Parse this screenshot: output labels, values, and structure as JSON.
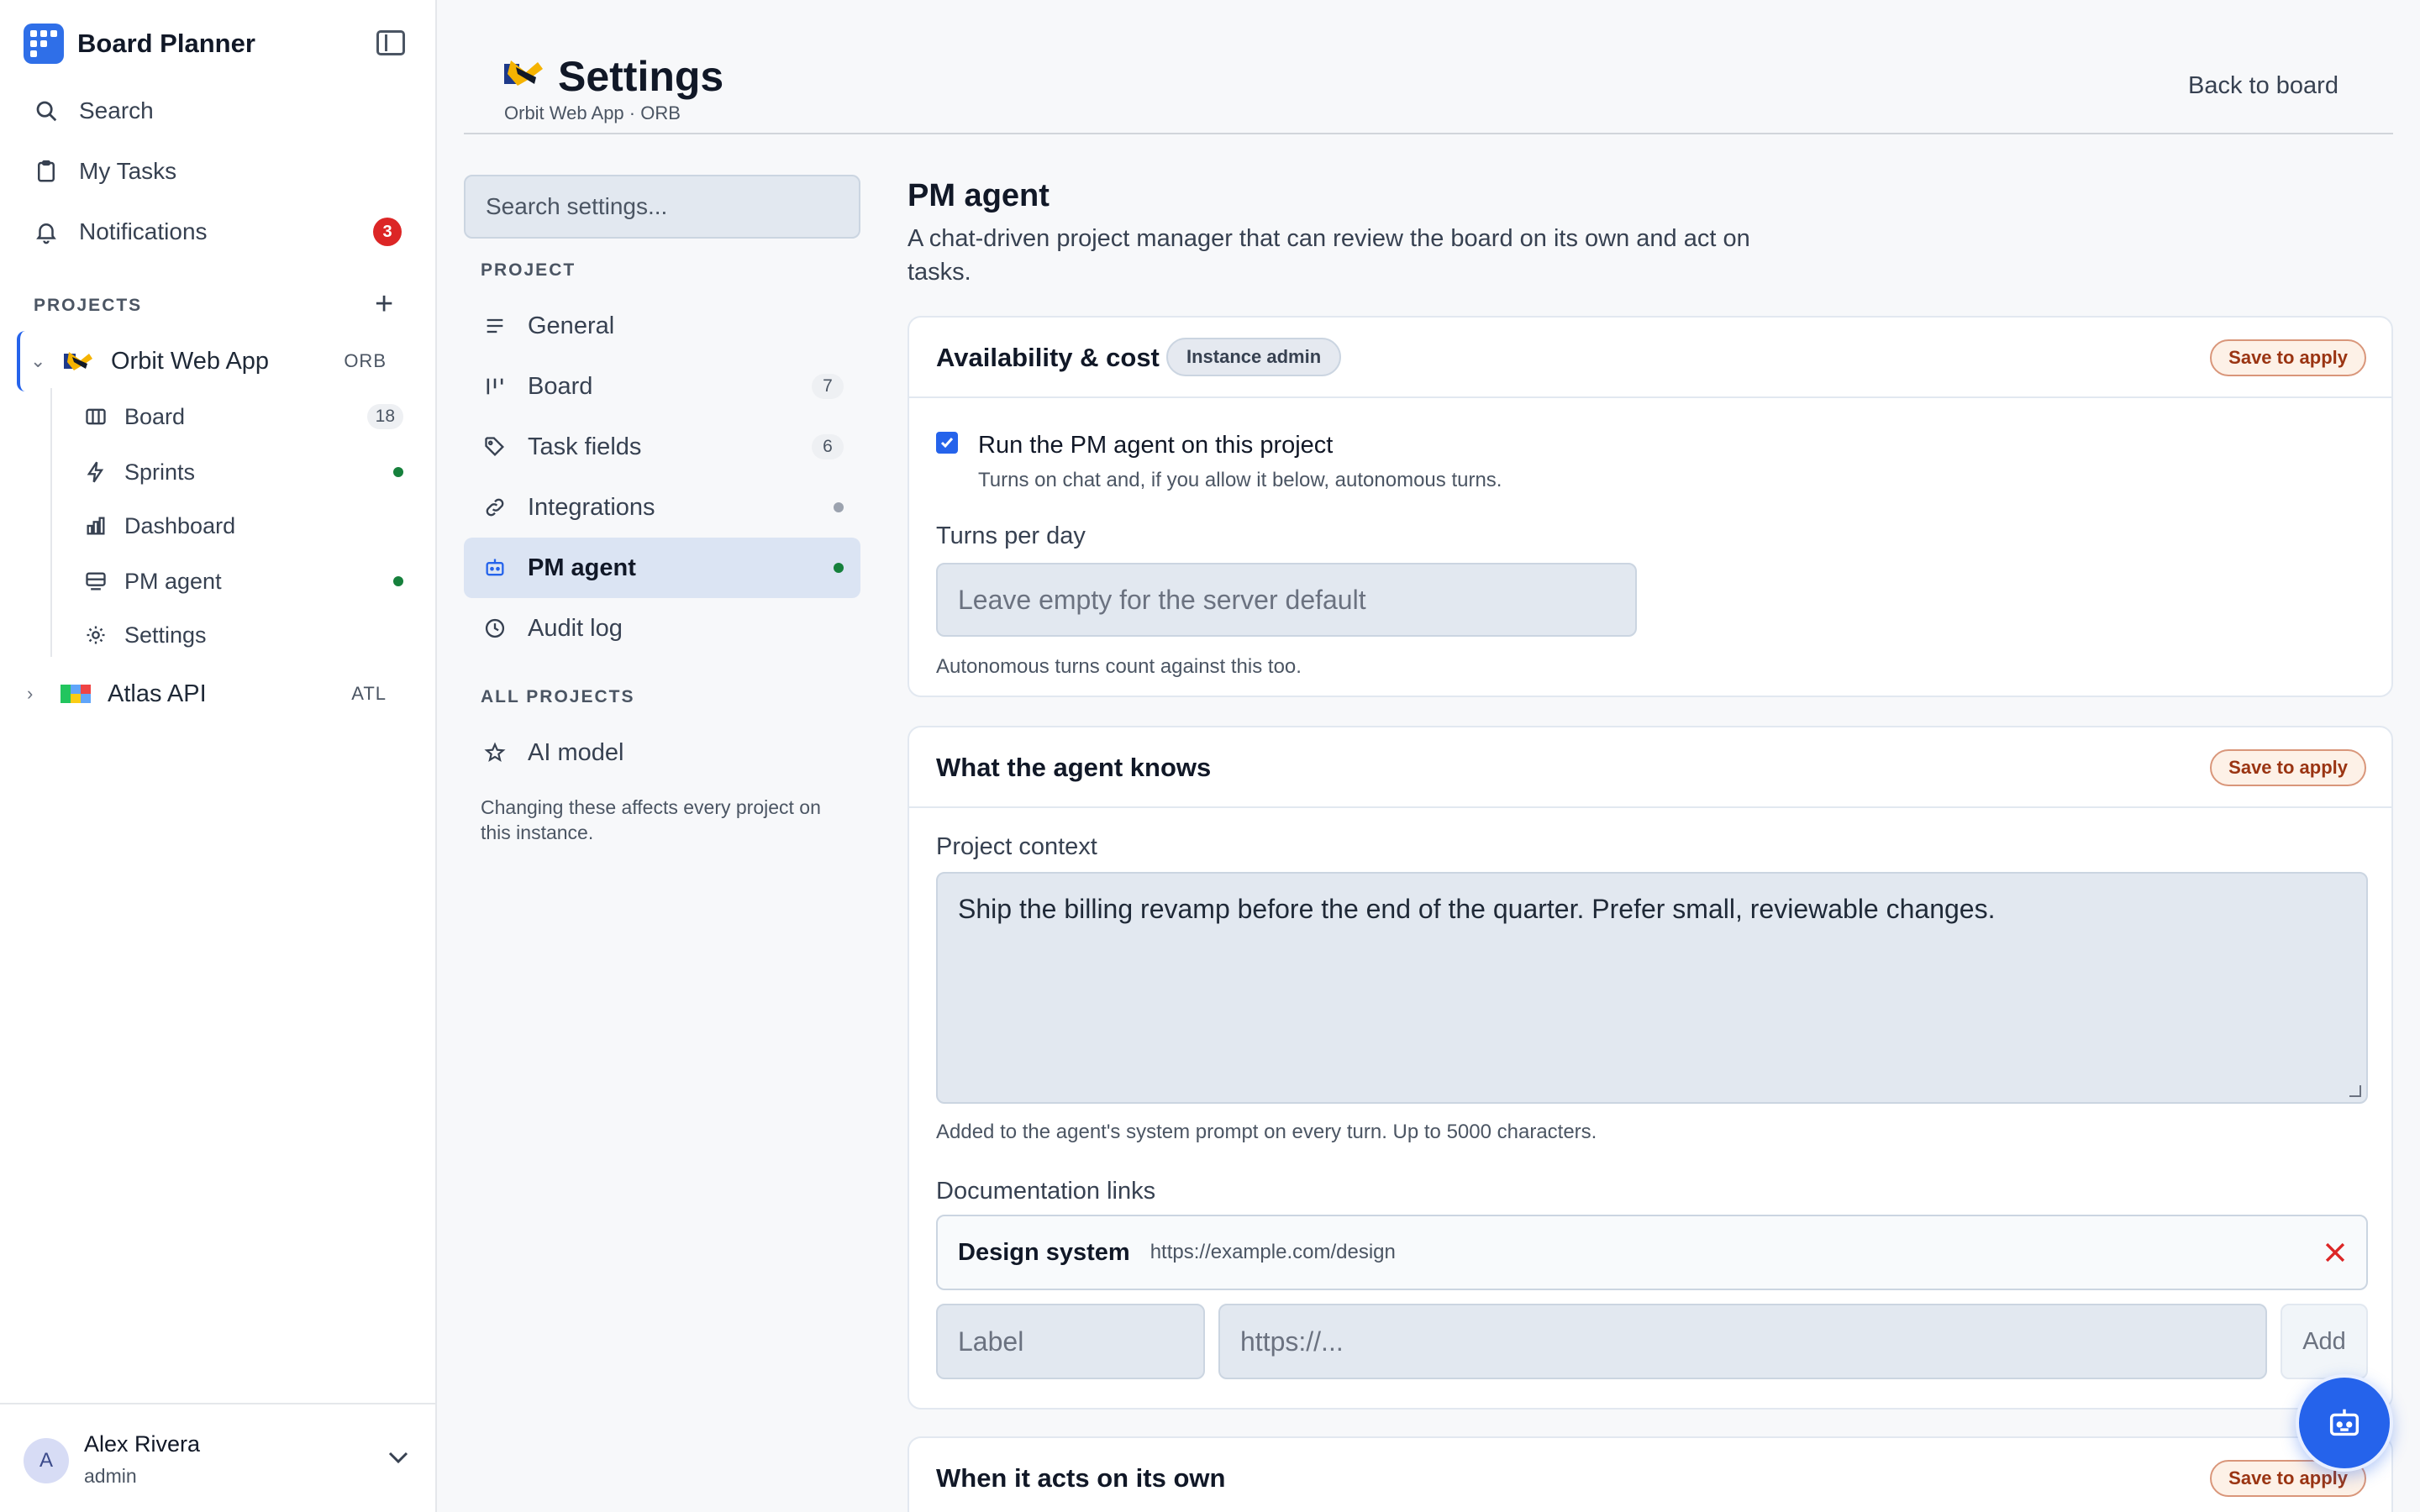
{
  "app": {
    "title": "Board Planner"
  },
  "sidebar": {
    "nav": [
      {
        "label": "Search",
        "icon": "search-icon"
      },
      {
        "label": "My Tasks",
        "icon": "clipboard-icon"
      },
      {
        "label": "Notifications",
        "icon": "bell-icon",
        "badge": "3"
      }
    ],
    "projects_label": "PROJECTS",
    "projects": [
      {
        "name": "Orbit Web App",
        "key": "ORB",
        "expanded": true,
        "children": [
          {
            "label": "Board",
            "icon": "board-icon",
            "count": "18"
          },
          {
            "label": "Sprints",
            "icon": "lightning-icon",
            "status": "green-dot"
          },
          {
            "label": "Dashboard",
            "icon": "chart-icon"
          },
          {
            "label": "PM agent",
            "icon": "monitor-icon",
            "status": "green-dot"
          },
          {
            "label": "Settings",
            "icon": "gear-icon"
          }
        ]
      },
      {
        "name": "Atlas API",
        "key": "ATL",
        "expanded": false
      }
    ],
    "user": {
      "initial": "A",
      "name": "Alex Rivera",
      "role": "admin"
    }
  },
  "header": {
    "title": "Settings",
    "subtitle": "Orbit Web App · ORB",
    "back_label": "Back to board"
  },
  "settings_nav": {
    "search_placeholder": "Search settings...",
    "project_label": "PROJECT",
    "project_items": [
      {
        "label": "General",
        "icon": "lines-icon"
      },
      {
        "label": "Board",
        "icon": "columns-icon",
        "count": "7"
      },
      {
        "label": "Task fields",
        "icon": "tag-icon",
        "count": "6"
      },
      {
        "label": "Integrations",
        "icon": "link-icon",
        "status": "gray-dot"
      },
      {
        "label": "PM agent",
        "icon": "robot-icon",
        "status": "green-dot",
        "active": true
      },
      {
        "label": "Audit log",
        "icon": "clock-icon"
      }
    ],
    "all_projects_label": "ALL PROJECTS",
    "all_items": [
      {
        "label": "AI model",
        "icon": "star-icon"
      }
    ],
    "note": "Changing these affects every project on this instance."
  },
  "main": {
    "title": "PM agent",
    "description": "A chat-driven project manager that can review the board on its own and act on tasks.",
    "cards": {
      "availability": {
        "title": "Availability & cost",
        "tag": "Instance admin",
        "save_label": "Save to apply",
        "checkbox_label": "Run the PM agent on this project",
        "checkbox_checked": true,
        "checkbox_help": "Turns on chat and, if you allow it below, autonomous turns.",
        "turns_label": "Turns per day",
        "turns_placeholder": "Leave empty for the server default",
        "turns_help": "Autonomous turns count against this too."
      },
      "knowledge": {
        "title": "What the agent knows",
        "save_label": "Save to apply",
        "context_label": "Project context",
        "context_value": "Ship the billing revamp before the end of the quarter. Prefer small, reviewable changes.",
        "context_help": "Added to the agent's system prompt on every turn. Up to 5000 characters.",
        "docs_label": "Documentation links",
        "links": [
          {
            "label": "Design system",
            "url": "https://example.com/design"
          }
        ],
        "new_label_placeholder": "Label",
        "new_url_placeholder": "https://...",
        "add_label": "Add"
      },
      "autonomy": {
        "title": "When it acts on its own",
        "save_label": "Save to apply"
      }
    }
  },
  "colors": {
    "accent": "#2563eb",
    "badge_red": "#dc2626",
    "status_green": "#16803c",
    "save_pill_border": "#d9967a"
  }
}
